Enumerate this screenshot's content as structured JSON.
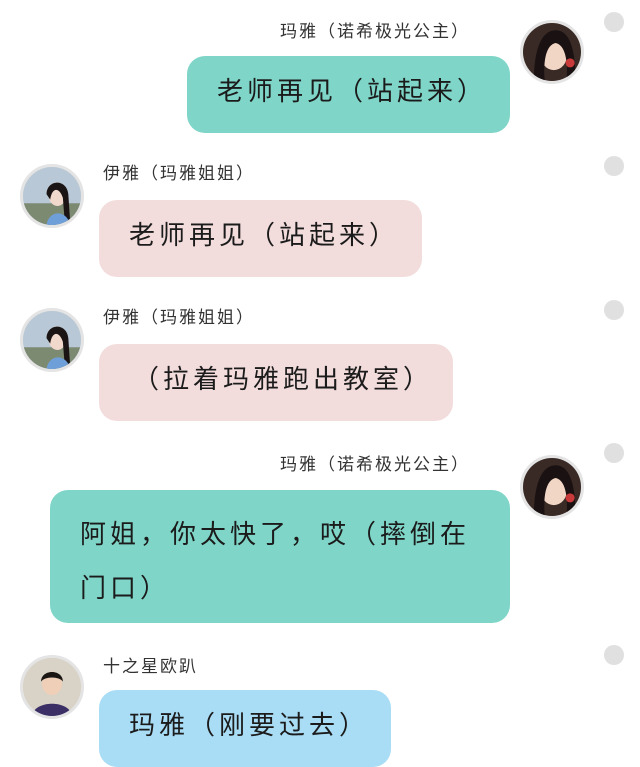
{
  "messages": [
    {
      "sender": "玛雅（诺希极光公主）",
      "text": "老师再见（站起来）",
      "side": "right",
      "bubble_color": "#7fd6c8",
      "avatar_icon": "girl-portrait-avatar"
    },
    {
      "sender": "伊雅（玛雅姐姐）",
      "text": "老师再见（站起来）",
      "side": "left",
      "bubble_color": "#f3dcdc",
      "avatar_icon": "girl-outdoor-avatar"
    },
    {
      "sender": "伊雅（玛雅姐姐）",
      "text": "（拉着玛雅跑出教室）",
      "side": "left",
      "bubble_color": "#f3dcdc",
      "avatar_icon": "girl-outdoor-avatar"
    },
    {
      "sender": "玛雅（诺希极光公主）",
      "text": "阿姐，你太快了，哎（摔倒在门口）",
      "side": "right",
      "bubble_color": "#7fd6c8",
      "avatar_icon": "girl-portrait-avatar"
    },
    {
      "sender": "十之星欧趴",
      "text": "玛雅（刚要过去）",
      "side": "left",
      "bubble_color": "#a9dcf5",
      "avatar_icon": "boy-avatar"
    }
  ]
}
